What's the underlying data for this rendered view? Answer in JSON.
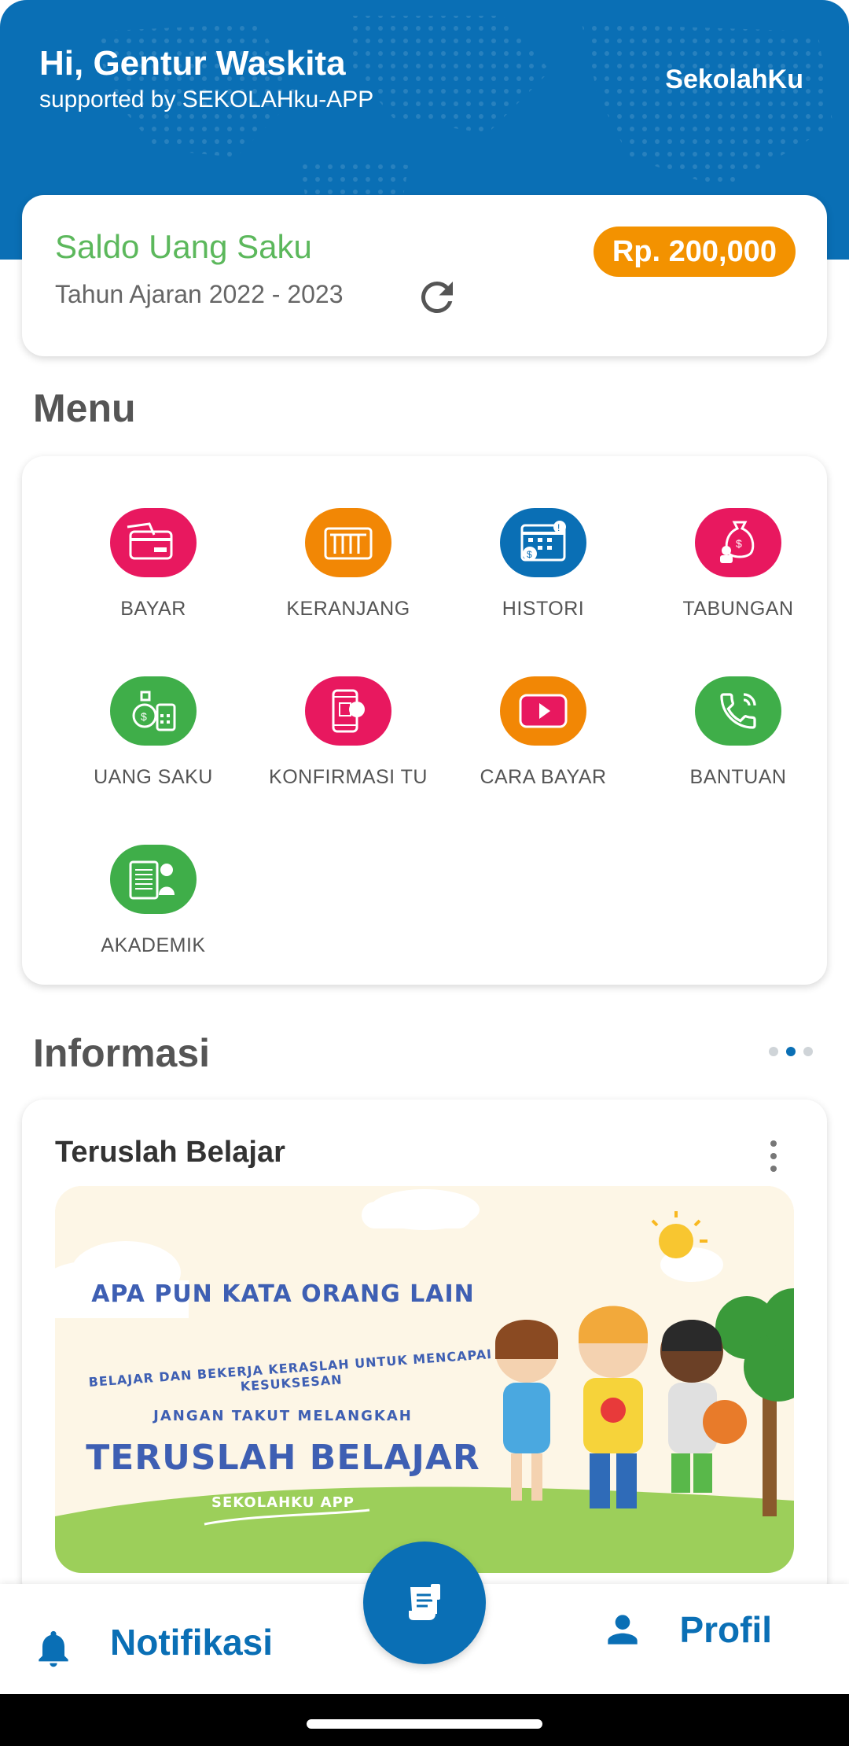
{
  "header": {
    "greeting": "Hi, Gentur Waskita",
    "supported_by": "supported by SEKOLAHku-APP",
    "brand": "SekolahKu"
  },
  "balance": {
    "title": "Saldo Uang Saku",
    "year": "Tahun Ajaran 2022 - 2023",
    "amount": "Rp. 200,000"
  },
  "menu": {
    "title": "Menu",
    "items": [
      {
        "label": "BAYAR",
        "icon": "card-payment-icon",
        "color": "#e8185f"
      },
      {
        "label": "KERANJANG",
        "icon": "cart-icon",
        "color": "#f28705"
      },
      {
        "label": "HISTORI",
        "icon": "calendar-history-icon",
        "color": "#0a6fb5"
      },
      {
        "label": "TABUNGAN",
        "icon": "money-bag-icon",
        "color": "#e8185f"
      },
      {
        "label": "UANG SAKU",
        "icon": "money-calculator-icon",
        "color": "#3fae49"
      },
      {
        "label": "KONFIRMASI TU",
        "icon": "phone-confirm-icon",
        "color": "#e8185f"
      },
      {
        "label": "CARA BAYAR",
        "icon": "video-play-icon",
        "color": "#f28705"
      },
      {
        "label": "BANTUAN",
        "icon": "phone-call-icon",
        "color": "#3fae49"
      },
      {
        "label": "AKADEMIK",
        "icon": "academic-report-icon",
        "color": "#3fae49"
      }
    ]
  },
  "info": {
    "title": "Informasi",
    "card_title": "Teruslah Belajar",
    "banner": {
      "line1": "APA PUN KATA ORANG LAIN",
      "line2": "BELAJAR DAN BEKERJA KERASLAH UNTUK MENCAPAI KESUKSESAN",
      "line3": "JANGAN TAKUT MELANGKAH",
      "line4": "TERUSLAH BELAJAR",
      "line5": "SEKOLAHKU APP"
    }
  },
  "bottom_nav": {
    "notifications": "Notifikasi",
    "profile": "Profil"
  },
  "colors": {
    "primary": "#0a6fb5",
    "accent_orange": "#f39200",
    "accent_green": "#5cb85c"
  }
}
